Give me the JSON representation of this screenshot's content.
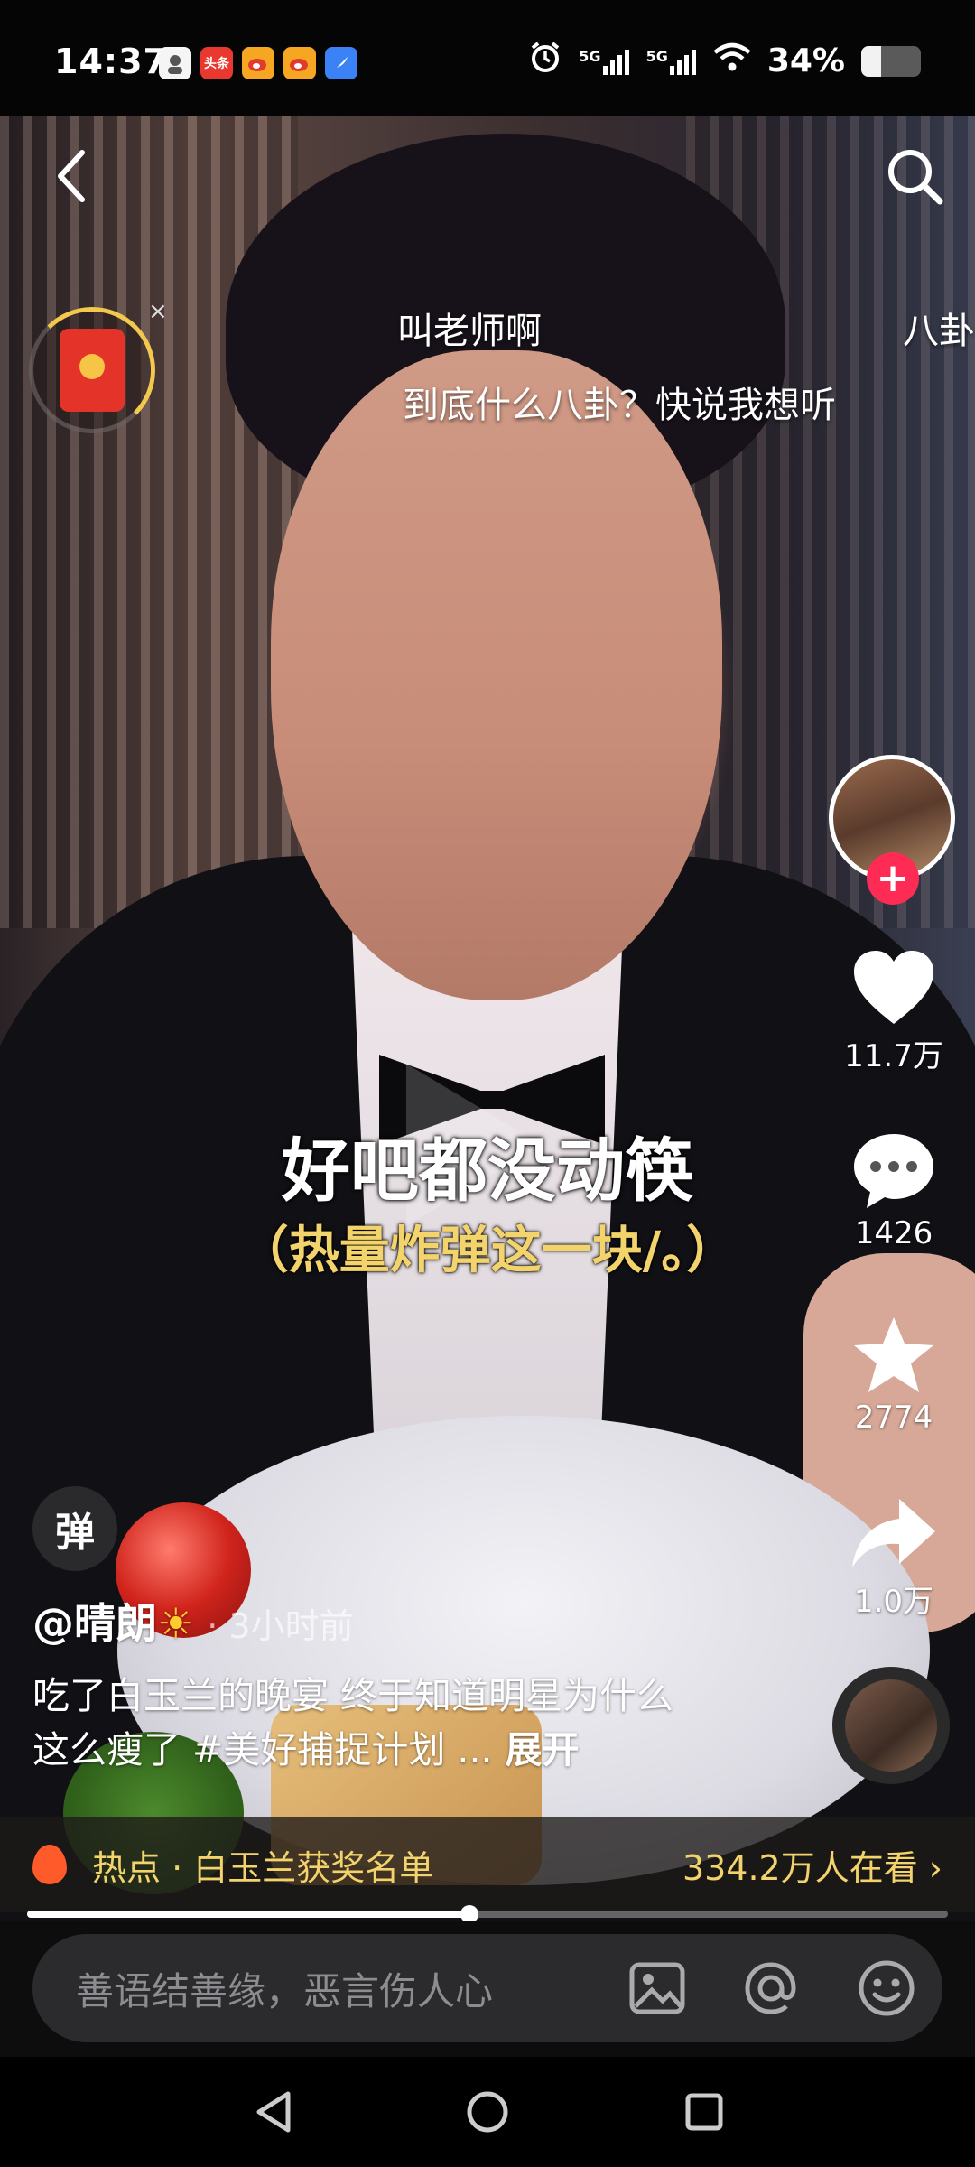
{
  "status_bar": {
    "time": "14:37",
    "notification_apps": [
      {
        "name": "avatar-app-icon",
        "text": "",
        "color": "#f5f5f5"
      },
      {
        "name": "toutiao-icon",
        "text": "头条",
        "color": "#e8382f"
      },
      {
        "name": "weibo-icon",
        "text": "",
        "color": "#f5a623"
      },
      {
        "name": "weibo-icon",
        "text": "",
        "color": "#f5a623"
      },
      {
        "name": "feather-app-icon",
        "text": "",
        "color": "#3b82f6"
      }
    ],
    "network_1": "5G",
    "network_2": "5G",
    "battery_text": "34%",
    "battery_level": 0.34
  },
  "top": {
    "back_icon": "chevron-left-icon",
    "search_icon": "search-icon"
  },
  "danmaku": [
    {
      "text": "叫老师啊"
    },
    {
      "text": "八卦"
    },
    {
      "text": "到底什么八卦？快说我想听"
    }
  ],
  "video": {
    "subtitle_main": "好吧都没动筷",
    "subtitle_sub": "（热量炸弹这一块/。）",
    "progress": 0.48
  },
  "right_rail": {
    "likes": "11.7万",
    "comments": "1426",
    "favorites": "2774",
    "shares": "1.0万",
    "follow_symbol": "+"
  },
  "danmu_toggle": "弹",
  "caption": {
    "username": "@晴朗",
    "username_emoji": "☀",
    "time": "· 3小时前",
    "text": "吃了白玉兰的晚宴 终于知道明星为什么这么瘦了 #美好捕捉计划 ...",
    "expand": "展开"
  },
  "hot": {
    "label": "热点 · 白玉兰获奖名单",
    "viewers": "334.2万人在看 ›"
  },
  "comment_bar": {
    "placeholder": "善语结善缘，恶言伤人心"
  },
  "colors": {
    "accent_red": "#fe2c55",
    "hot_yellow": "#f3d36b"
  }
}
